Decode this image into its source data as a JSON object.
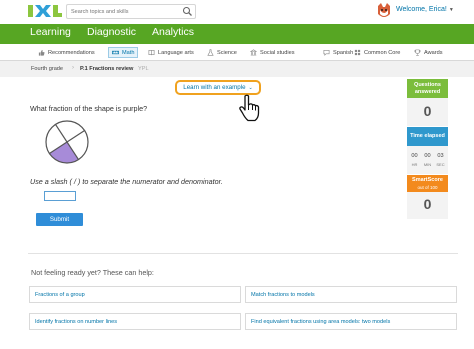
{
  "header": {
    "logo_text": "IXL",
    "search": {
      "placeholder": "Search topics and skills"
    },
    "welcome": "Welcome, Erica!"
  },
  "nav": {
    "tabs": [
      {
        "label": "Learning",
        "active": true
      },
      {
        "label": "Diagnostic",
        "active": false
      },
      {
        "label": "Analytics",
        "active": false
      }
    ]
  },
  "subjects": {
    "items": [
      {
        "label": "Recommendations",
        "icon": "thumbs-up-icon",
        "active": false
      },
      {
        "label": "Math",
        "icon": "ruler-icon",
        "active": true
      },
      {
        "label": "Language arts",
        "icon": "book-icon",
        "active": false
      },
      {
        "label": "Science",
        "icon": "flask-icon",
        "active": false
      },
      {
        "label": "Social studies",
        "icon": "landmark-icon",
        "active": false
      },
      {
        "label": "Spanish",
        "icon": "speech-icon",
        "active": false
      },
      {
        "label": "Common Core",
        "icon": "grid-icon",
        "active": false
      },
      {
        "label": "Awards",
        "icon": "trophy-icon",
        "active": false
      }
    ]
  },
  "breadcrumb": {
    "grade": "Fourth grade",
    "skill": "P.1 Fractions review",
    "code": "YPL"
  },
  "practice": {
    "learn_button": "Learn with an example",
    "question": "What fraction of the shape is purple?",
    "instruction": "Use a slash ( / ) to separate the numerator and denominator.",
    "answer_value": "",
    "submit_label": "Submit",
    "shape": {
      "parts": 4,
      "shaded": 1,
      "shaded_color": "#a78bd8"
    }
  },
  "stats": {
    "questions_answered_label": "Questions answered",
    "questions_answered": "0",
    "time_elapsed_label": "Time elapsed",
    "timer": [
      {
        "value": "00",
        "label": "HR"
      },
      {
        "value": "00",
        "label": "MIN"
      },
      {
        "value": "03",
        "label": "SEC"
      }
    ],
    "smartscore_label": "SmartScore",
    "smartscore_sub": "out of 100",
    "smartscore": "0"
  },
  "help": {
    "title": "Not feeling ready yet? These can help:",
    "links": [
      "Fractions of a group",
      "Match fractions to models",
      "Identify fractions on number lines",
      "Find equivalent fractions using area models: two models"
    ]
  },
  "colors": {
    "nav_green": "#57a623",
    "link_blue": "#0074a8",
    "answered_green": "#7bbd3c",
    "time_blue": "#2f98cd",
    "smartscore_orange": "#f38a1d",
    "highlight_orange": "#f0a21f"
  }
}
